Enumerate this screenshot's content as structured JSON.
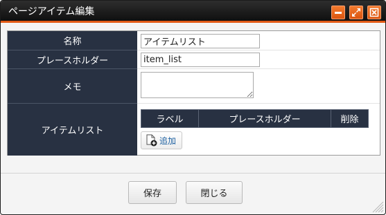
{
  "window": {
    "title": "ページアイテム編集",
    "controls": [
      "minimize-icon",
      "maximize-icon",
      "close-icon"
    ]
  },
  "form": {
    "name": {
      "label": "名称",
      "value": "アイテムリスト"
    },
    "placeholder": {
      "label": "プレースホルダー",
      "value": "item_list"
    },
    "memo": {
      "label": "メモ",
      "value": ""
    },
    "items": {
      "label": "アイテムリスト",
      "columns": [
        "ラベル",
        "プレースホルダー",
        "削除"
      ],
      "add_label": "追加"
    }
  },
  "buttons": {
    "save": "保存",
    "close": "閉じる"
  },
  "colors": {
    "titlebar": "#1a1a1a",
    "accent": "#e25a16",
    "label_bg": "#283142"
  }
}
